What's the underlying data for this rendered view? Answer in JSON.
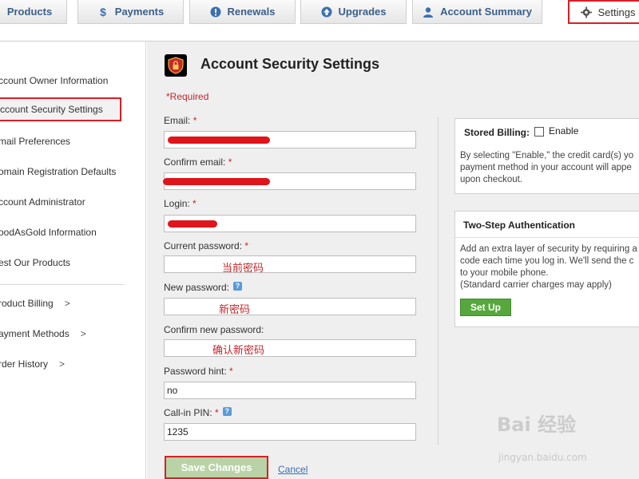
{
  "tabs": [
    {
      "label": "Products",
      "icon": "box-icon"
    },
    {
      "label": "Payments",
      "icon": "dollar-icon"
    },
    {
      "label": "Renewals",
      "icon": "alert-icon"
    },
    {
      "label": "Upgrades",
      "icon": "arrow-up-icon"
    },
    {
      "label": "Account Summary",
      "icon": "user-icon"
    },
    {
      "label": "Settings",
      "icon": "gear-icon"
    }
  ],
  "sidebar": {
    "items": [
      {
        "label": "ccount Owner Information"
      },
      {
        "label": "ccount Security Settings"
      },
      {
        "label": "mail Preferences"
      },
      {
        "label": "omain Registration Defaults"
      },
      {
        "label": "ccount Administrator"
      },
      {
        "label": "oodAsGold Information"
      },
      {
        "label": "est Our Products"
      },
      {
        "label": "roduct Billing",
        "chevron": ">"
      },
      {
        "label": "ayment Methods",
        "chevron": ">"
      },
      {
        "label": "rder History",
        "chevron": ">"
      }
    ]
  },
  "main": {
    "title": "Account Security Settings",
    "required_note": "*Required",
    "fields": {
      "email": {
        "label": "Email:",
        "star": "*"
      },
      "confirm_email": {
        "label": "Confirm email:",
        "star": "*"
      },
      "login": {
        "label": "Login:",
        "star": "*"
      },
      "current_password": {
        "label": "Current password:",
        "star": "*",
        "note": "当前密码"
      },
      "new_password": {
        "label": "New password:",
        "help": "?",
        "note": "新密码"
      },
      "confirm_new_password": {
        "label": "Confirm new password:",
        "note": "确认新密码"
      },
      "password_hint": {
        "label": "Password hint:",
        "star": "*",
        "value": "no"
      },
      "callin_pin": {
        "label": "Call-in PIN:",
        "star": "*",
        "help": "?",
        "value": "1235"
      }
    },
    "save_label": "Save Changes",
    "cancel_label": "Cancel"
  },
  "stored_billing": {
    "title": "Stored Billing:",
    "checkbox_label": "Enable",
    "text_lines": [
      "By selecting \"Enable,\" the credit card(s) yo",
      "payment method in your account will appe",
      "upon checkout."
    ]
  },
  "two_step": {
    "title": "Two-Step Authentication",
    "text_lines": [
      "Add an extra layer of security by requiring a",
      "code each time you log in. We'll send the c",
      "to your mobile phone.",
      "(Standard carrier charges may apply)"
    ],
    "button_label": "Set Up"
  },
  "watermark": {
    "text": "Bai 经验",
    "sub": "jingyan.baidu.com"
  },
  "colors": {
    "highlight": "#d81f26",
    "link": "#3a6fb0",
    "required": "#c1272d",
    "setup": "#56a83c"
  }
}
